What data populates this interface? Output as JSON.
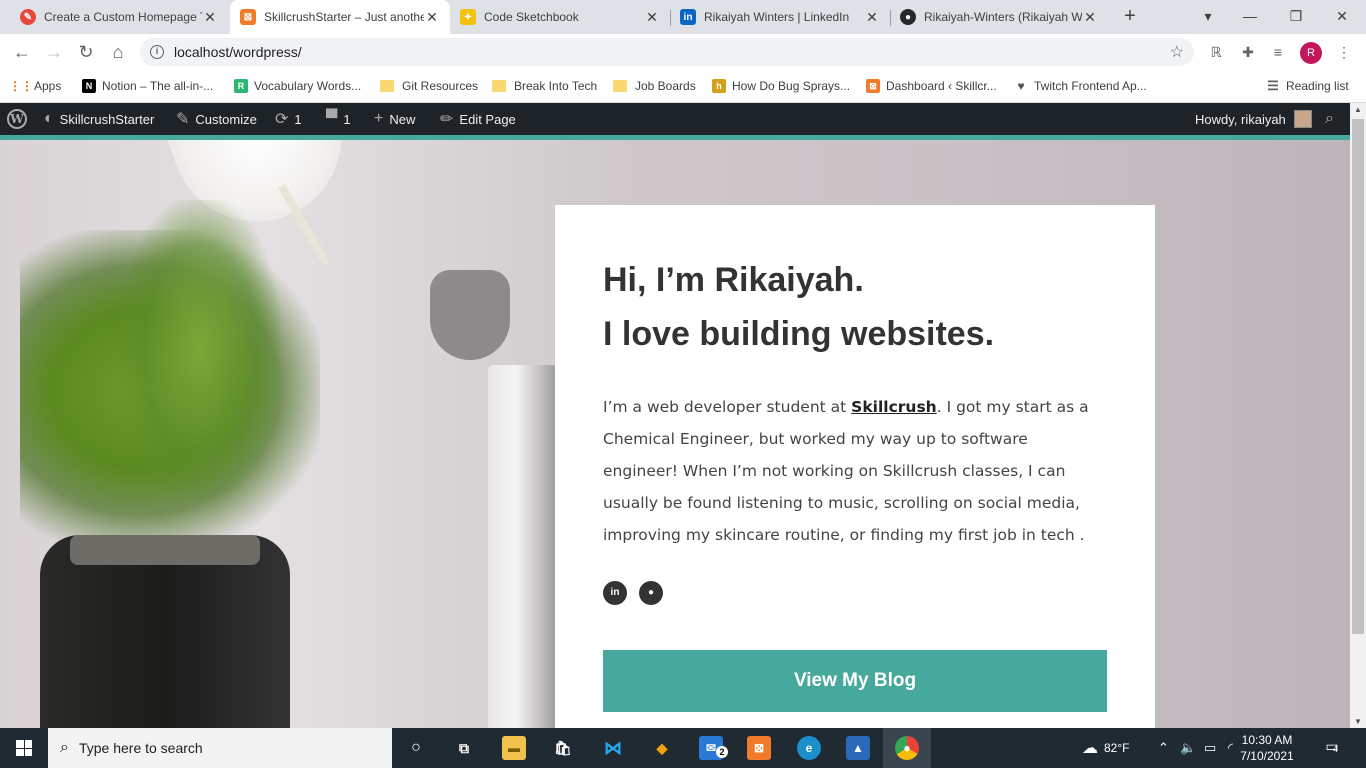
{
  "browser": {
    "tabs": [
      {
        "title": "Create a Custom Homepage T",
        "fav_color": "#e8453c",
        "fav_text": "✎"
      },
      {
        "title": "SkillcrushStarter – Just anothe",
        "fav_color": "#f07c2b",
        "fav_text": "⊠"
      },
      {
        "title": "Code Sketchbook",
        "fav_color": "#f4c20d",
        "fav_text": "✦"
      },
      {
        "title": "Rikaiyah Winters | LinkedIn",
        "fav_color": "#0a66c2",
        "fav_text": "in"
      },
      {
        "title": "Rikaiyah-Winters (Rikaiyah W",
        "fav_color": "#24292e",
        "fav_text": "●"
      }
    ],
    "url": "localhost/wordpress/",
    "profile_initial": "R",
    "bookmarks": {
      "apps": "Apps",
      "items": [
        {
          "label": "Notion – The all-in-...",
          "kind": "icon",
          "color": "#000",
          "text": "N"
        },
        {
          "label": "Vocabulary Words...",
          "kind": "icon",
          "color": "#2bb673",
          "text": "R"
        },
        {
          "label": "Git Resources",
          "kind": "folder"
        },
        {
          "label": "Break Into Tech",
          "kind": "folder"
        },
        {
          "label": "Job Boards",
          "kind": "folder"
        },
        {
          "label": "How Do Bug Sprays...",
          "kind": "icon",
          "color": "#d4a017",
          "text": "h"
        },
        {
          "label": "Dashboard ‹ Skillcr...",
          "kind": "icon",
          "color": "#f07c2b",
          "text": "⊠"
        },
        {
          "label": "Twitch Frontend Ap...",
          "kind": "icon",
          "color": "#555",
          "text": "♥"
        }
      ],
      "reading_list": "Reading list"
    }
  },
  "wp_admin": {
    "site_name": "SkillcrushStarter",
    "customize": "Customize",
    "updates_count": "1",
    "comments_count": "1",
    "new": "New",
    "edit_page": "Edit Page",
    "howdy": "Howdy, rikaiyah"
  },
  "hero": {
    "heading_line1": "Hi, I’m Rikaiyah.",
    "heading_line2": "I love building websites.",
    "bio_before_link": "I’m a web developer student at ",
    "bio_link": "Skillcrush",
    "bio_after_link": ". I got my start as a Chemical Engineer, but worked my way up to software engineer! When I’m not working on Skillcrush classes, I can usually be found listening to music, scrolling on social media, improving my skincare routine, or finding my first job in tech .",
    "social_icons": [
      "linkedin-icon",
      "github-icon"
    ],
    "cta": "View My Blog",
    "accent_color": "#47a99b"
  },
  "taskbar": {
    "search_placeholder": "Type here to search",
    "weather": "82°F",
    "time": "10:30 AM",
    "date": "7/10/2021",
    "mail_badge": "2",
    "notification_count": "4"
  }
}
